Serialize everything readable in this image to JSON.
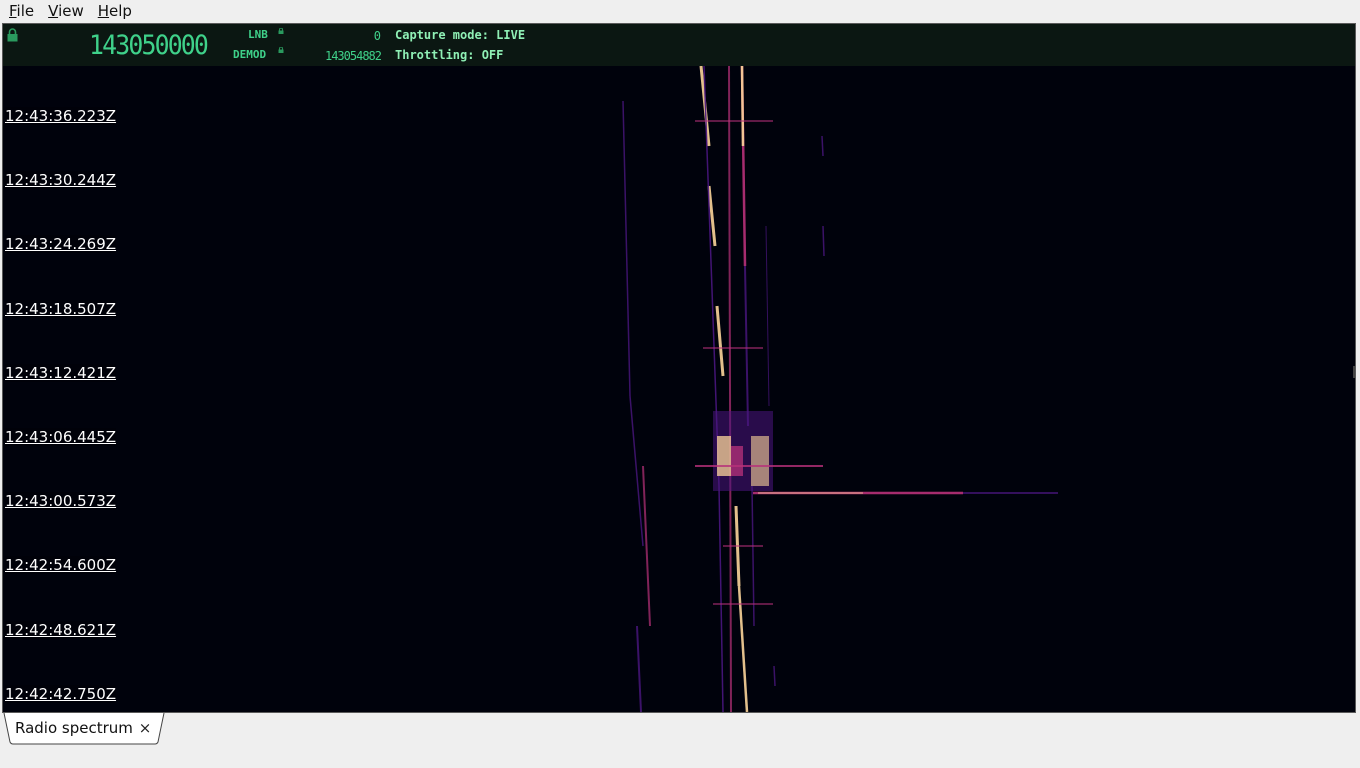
{
  "menubar": {
    "items": [
      {
        "label": "File",
        "mnemonic": "F",
        "rest": "ile"
      },
      {
        "label": "View",
        "mnemonic": "V",
        "rest": "iew"
      },
      {
        "label": "Help",
        "mnemonic": "H",
        "rest": "elp"
      }
    ]
  },
  "header": {
    "frequency": "143050000",
    "lnb_label": "LNB",
    "lnb_value": "0",
    "demod_label": "DEMOD",
    "demod_value": "143054882",
    "capture_mode": "Capture mode: LIVE",
    "throttling": "Throttling: OFF"
  },
  "waterfall": {
    "timestamps": [
      "12:43:36.223Z",
      "12:43:30.244Z",
      "12:43:24.269Z",
      "12:43:18.507Z",
      "12:43:12.421Z",
      "12:43:06.445Z",
      "12:43:00.573Z",
      "12:42:54.600Z",
      "12:42:48.621Z",
      "12:42:42.750Z"
    ],
    "colors": {
      "background": "#00020c",
      "dim": "#4a1680",
      "mid": "#b8317a",
      "hot": "#fcd59a"
    }
  },
  "tabs": [
    {
      "label": "Radio spectrum",
      "close": "×"
    }
  ]
}
